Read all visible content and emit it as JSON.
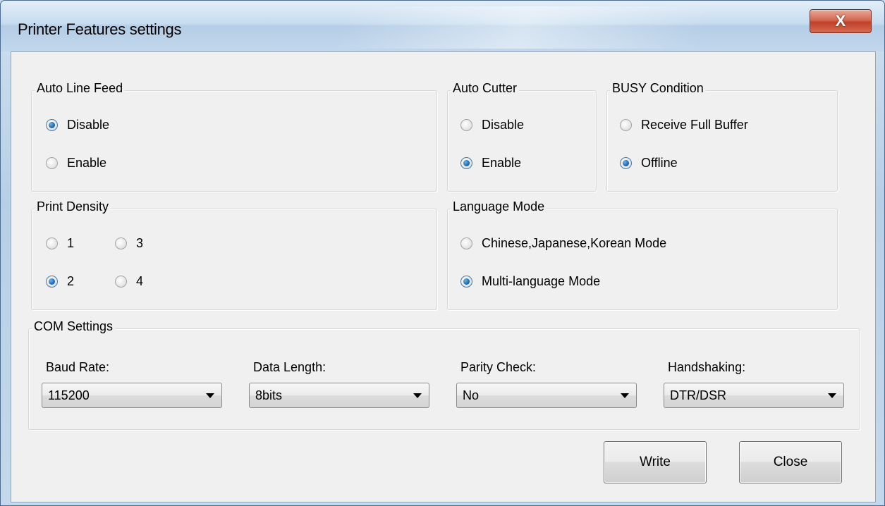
{
  "window": {
    "title": "Printer Features settings",
    "close_glyph": "X"
  },
  "auto_line_feed": {
    "label": "Auto Line Feed",
    "options": [
      "Disable",
      "Enable"
    ],
    "selected": "Disable"
  },
  "auto_cutter": {
    "label": "Auto Cutter",
    "options": [
      "Disable",
      "Enable"
    ],
    "selected": "Enable"
  },
  "busy_condition": {
    "label": "BUSY Condition",
    "options": [
      "Receive Full Buffer",
      "Offline"
    ],
    "selected": "Offline"
  },
  "print_density": {
    "label": "Print Density",
    "options": [
      "1",
      "3",
      "2",
      "4"
    ],
    "selected": "2"
  },
  "language_mode": {
    "label": "Language Mode",
    "options": [
      "Chinese,Japanese,Korean Mode",
      "Multi-language Mode"
    ],
    "selected": "Multi-language Mode"
  },
  "com_settings": {
    "label": "COM Settings",
    "baud_rate": {
      "label": "Baud Rate:",
      "value": "115200"
    },
    "data_length": {
      "label": "Data Length:",
      "value": "8bits"
    },
    "parity_check": {
      "label": "Parity Check:",
      "value": "No"
    },
    "handshaking": {
      "label": "Handshaking:",
      "value": "DTR/DSR"
    }
  },
  "buttons": {
    "write": "Write",
    "close": "Close"
  },
  "icons": {
    "close": "close-icon",
    "dropdown": "chevron-down-icon",
    "radio": "radio-icon"
  }
}
